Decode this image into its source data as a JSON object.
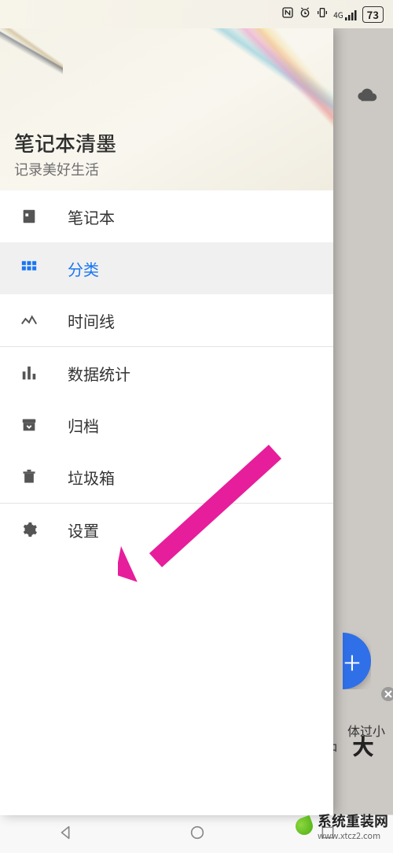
{
  "statusbar": {
    "battery": "73",
    "network": "4G"
  },
  "background": {
    "small_text": "体过小",
    "mid": "中",
    "big": "大"
  },
  "drawer": {
    "title": "笔记本清墨",
    "subtitle": "记录美好生活",
    "items": [
      {
        "icon": "notebook-icon",
        "label": "笔记本",
        "active": false
      },
      {
        "icon": "grid-icon",
        "label": "分类",
        "active": true
      },
      {
        "icon": "timeline-icon",
        "label": "时间线",
        "active": false
      }
    ],
    "items2": [
      {
        "icon": "stats-icon",
        "label": "数据统计"
      },
      {
        "icon": "archive-icon",
        "label": "归档"
      },
      {
        "icon": "trash-icon",
        "label": "垃圾箱"
      }
    ],
    "items3": [
      {
        "icon": "settings-icon",
        "label": "设置"
      }
    ]
  },
  "fab": {
    "plus": "+"
  },
  "watermark": {
    "main": "系统重装网",
    "sub": "www.xtcz2.com"
  },
  "colors": {
    "accent": "#1976f2",
    "arrow": "#e91e8c"
  }
}
